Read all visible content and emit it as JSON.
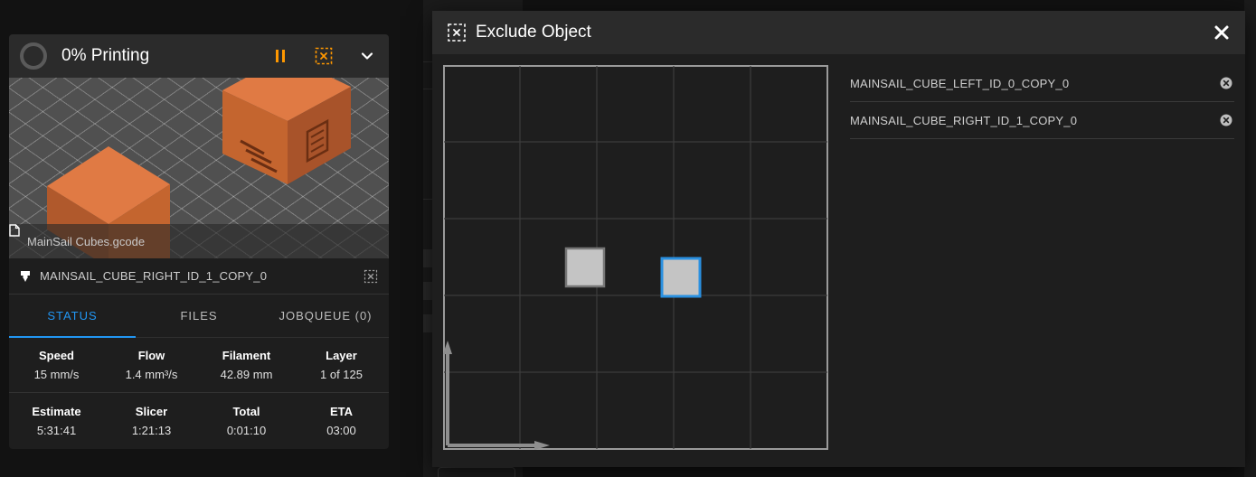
{
  "colors": {
    "accent": "#2196f3",
    "warning": "#ff9800",
    "object_fill": "#c4c4c4",
    "object_hover_border": "#2a90e0"
  },
  "status_panel": {
    "title": "0% Printing",
    "progress": 0,
    "icons": [
      "progress-ring-icon",
      "pause-icon",
      "exclude-object-icon",
      "chevron-down-icon"
    ],
    "thumbnail": {
      "filename": "MainSail Cubes.gcode"
    },
    "current_object": "MAINSAIL_CUBE_RIGHT_ID_1_COPY_0",
    "tabs": [
      {
        "label": "STATUS",
        "active": true
      },
      {
        "label": "FILES",
        "active": false
      },
      {
        "label": "JOBQUEUE (0)",
        "active": false
      }
    ],
    "stats_row1": [
      {
        "name": "Speed",
        "value": "15 mm/s"
      },
      {
        "name": "Flow",
        "value": "1.4 mm³/s"
      },
      {
        "name": "Filament",
        "value": "42.89 mm"
      },
      {
        "name": "Layer",
        "value": "1 of 125"
      }
    ],
    "stats_row2": [
      {
        "name": "Estimate",
        "value": "5:31:41"
      },
      {
        "name": "Slicer",
        "value": "1:21:13"
      },
      {
        "name": "Total",
        "value": "0:01:10"
      },
      {
        "name": "ETA",
        "value": "03:00"
      }
    ]
  },
  "dialog": {
    "title": "Exclude Object",
    "icons": [
      "exclude-object-icon",
      "close-icon"
    ],
    "objects": [
      {
        "name": "MAINSAIL_CUBE_LEFT_ID_0_COPY_0",
        "highlighted": false
      },
      {
        "name": "MAINSAIL_CUBE_RIGHT_ID_1_COPY_0",
        "highlighted": true
      }
    ]
  }
}
